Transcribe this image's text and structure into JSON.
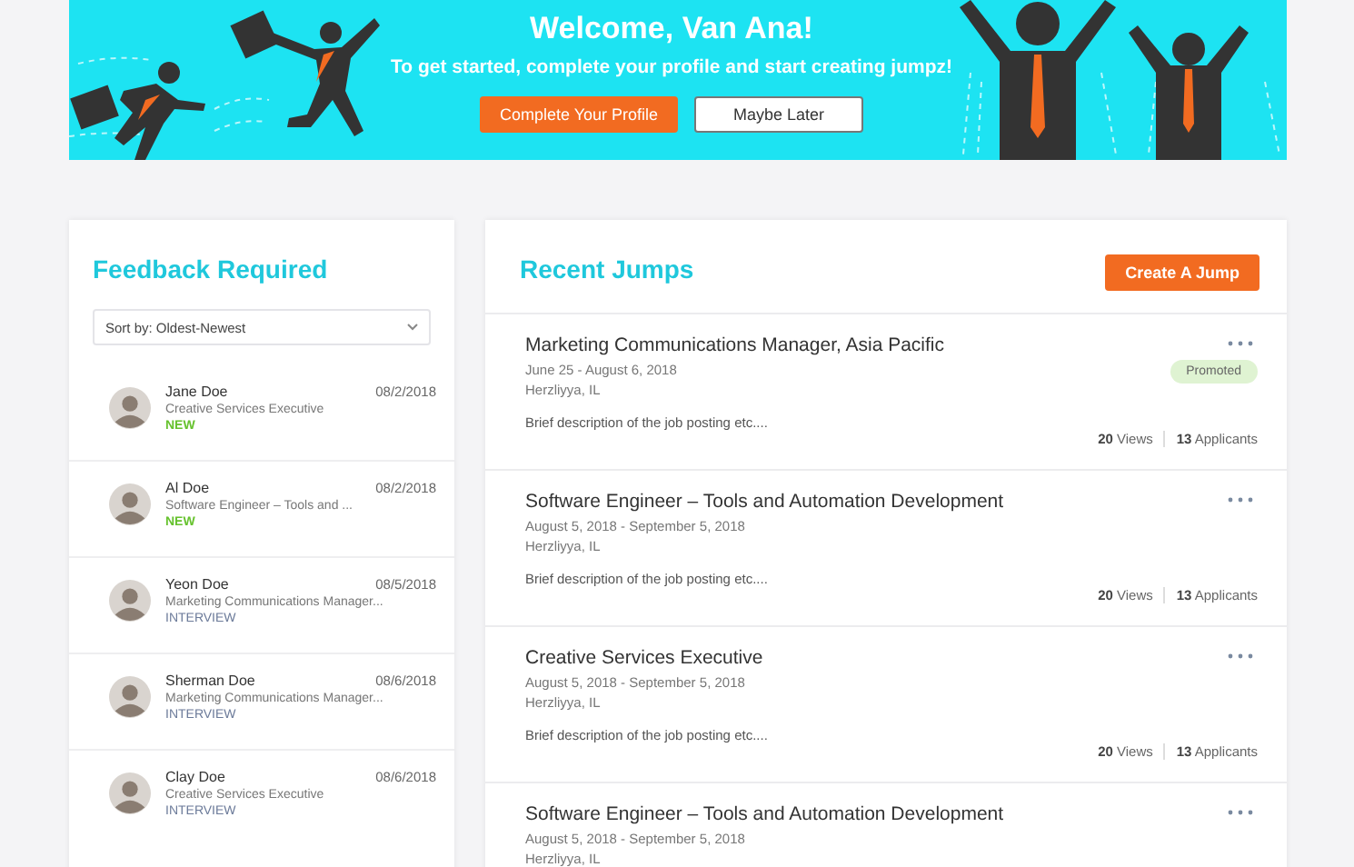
{
  "banner": {
    "title": "Welcome, Van Ana!",
    "subtitle": "To get started, complete your profile and start creating jumpz!",
    "primary_button": "Complete Your Profile",
    "secondary_button": "Maybe Later"
  },
  "feedback": {
    "title": "Feedback Required",
    "sort": {
      "value": "Sort by: Oldest-Newest"
    },
    "items": [
      {
        "name": "Jane Doe",
        "date": "08/2/2018",
        "role": "Creative Services Executive",
        "status": "NEW",
        "kind": "new"
      },
      {
        "name": "Al Doe",
        "date": "08/2/2018",
        "role": "Software Engineer – Tools and ...",
        "status": "NEW",
        "kind": "new"
      },
      {
        "name": "Yeon Doe",
        "date": "08/5/2018",
        "role": "Marketing Communications Manager...",
        "status": "INTERVIEW",
        "kind": "interview"
      },
      {
        "name": "Sherman Doe",
        "date": "08/6/2018",
        "role": "Marketing Communications Manager...",
        "status": "INTERVIEW",
        "kind": "interview"
      },
      {
        "name": "Clay Doe",
        "date": "08/6/2018",
        "role": "Creative Services Executive",
        "status": "INTERVIEW",
        "kind": "interview"
      }
    ]
  },
  "jumps": {
    "title": "Recent Jumps",
    "create_button": "Create A Jump",
    "items": [
      {
        "title": "Marketing Communications Manager, Asia Pacific",
        "dates": "June 25 - August 6, 2018",
        "location": "Herzliyya, IL",
        "description": "Brief description of the job posting etc....",
        "badge": "Promoted",
        "views": "**20** Views",
        "applicants": "**13** Applicants"
      },
      {
        "title": "Software Engineer – Tools and Automation Development",
        "dates": "August 5, 2018 - September 5, 2018",
        "location": "Herzliyya, IL",
        "description": "Brief description of the job posting etc....",
        "views": "**20** Views",
        "applicants": "**13** Applicants"
      },
      {
        "title": "Creative Services Executive",
        "dates": "August 5, 2018 - September 5, 2018",
        "location": "Herzliyya, IL",
        "description": "Brief description of the job posting etc....",
        "views": "**20** Views",
        "applicants": "**13** Applicants"
      },
      {
        "title": "Software Engineer – Tools and Automation Development",
        "dates": "August 5, 2018 - September 5, 2018",
        "location": "Herzliyya, IL"
      }
    ]
  }
}
